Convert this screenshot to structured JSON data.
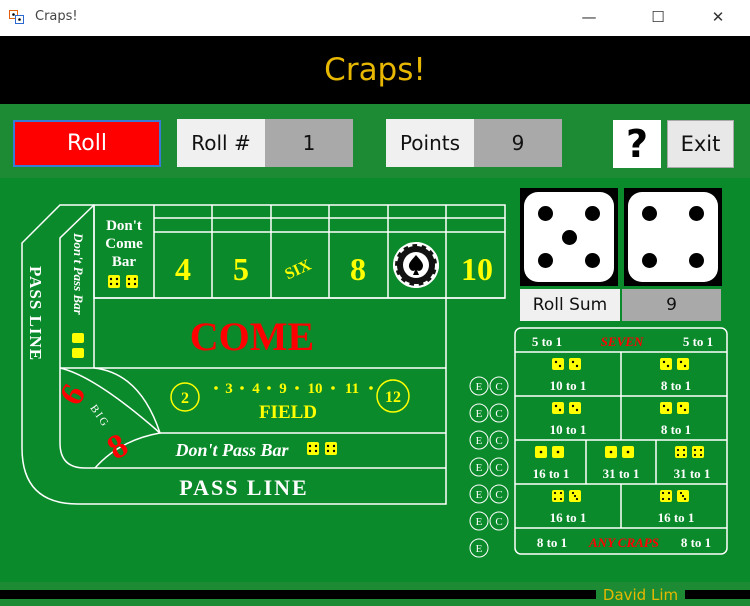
{
  "window": {
    "title": "Craps!",
    "minimize_glyph": "—",
    "maximize_glyph": "☐",
    "close_glyph": "✕"
  },
  "header": {
    "title": "Craps!"
  },
  "toolbar": {
    "roll_label": "Roll",
    "roll_number_label": "Roll #",
    "roll_number_value": "1",
    "points_label": "Points",
    "points_value": "9",
    "help_label": "?",
    "exit_label": "Exit"
  },
  "dice": {
    "die1": 5,
    "die2": 4,
    "roll_sum_label": "Roll Sum",
    "roll_sum_value": "9"
  },
  "board": {
    "dont_come_bar": [
      "Don't",
      "Come",
      "Bar"
    ],
    "dont_pass_bar_vertical": "Don't Pass Bar",
    "pass_line_vertical": "PASS LINE",
    "place_numbers": [
      "4",
      "5",
      "SIX",
      "8",
      "",
      "10"
    ],
    "come": "COME",
    "field_numbers": [
      "2",
      "3",
      "4",
      "9",
      "10",
      "11",
      "12"
    ],
    "field_label": "FIELD",
    "big_six": "6",
    "big_eight": "8",
    "big_label": "BIG",
    "dont_pass_bar": "Don't Pass Bar",
    "pass_line": "PASS LINE",
    "ce_labels": [
      "E",
      "C"
    ]
  },
  "proposition": {
    "seven_row": {
      "left": "5 to 1",
      "center": "SEVEN",
      "right": "5 to 1"
    },
    "hardways": [
      "10 to 1",
      "8 to 1",
      "10 to 1",
      "8 to 1"
    ],
    "horn_row": [
      "16 to 1",
      "31 to 1",
      "31 to 1"
    ],
    "eleven_row": [
      "16 to 1",
      "16 to 1"
    ],
    "craps_row": {
      "left": "8 to 1",
      "center": "ANY CRAPS",
      "right": "8 to 1"
    }
  },
  "footer": {
    "author": "David Lim"
  },
  "colors": {
    "felt": "#0b8a2b",
    "accent_yellow": "#ffff00",
    "accent_red": "#ff0000",
    "title_gold": "#e8b800"
  }
}
